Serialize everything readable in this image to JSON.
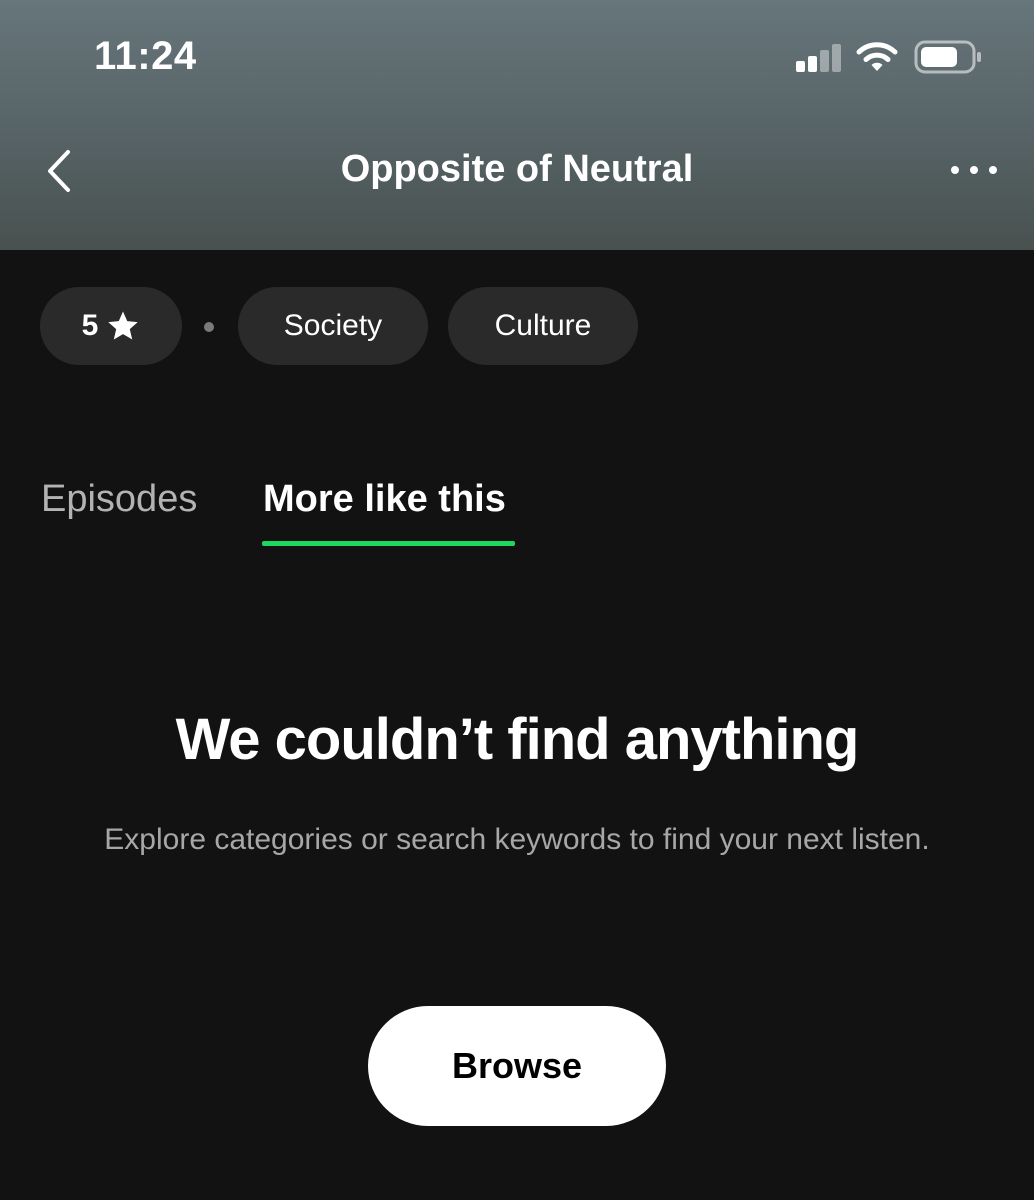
{
  "status_bar": {
    "time": "11:24",
    "signal_icon": "cellular-signal-icon",
    "wifi_icon": "wifi-icon",
    "battery_icon": "battery-icon"
  },
  "nav": {
    "back_icon": "chevron-left-icon",
    "title": "Opposite of Neutral",
    "more_icon": "more-horizontal-icon"
  },
  "chips": {
    "rating": "5",
    "rating_icon": "star-icon",
    "categories": [
      "Society",
      "Culture"
    ]
  },
  "tabs": [
    {
      "label": "Episodes",
      "active": false
    },
    {
      "label": "More like this",
      "active": true
    }
  ],
  "empty_state": {
    "title": "We couldn’t find anything",
    "message": "Explore categories or search keywords to find your next listen.",
    "button_label": "Browse"
  },
  "colors": {
    "background": "#121212",
    "accent": "#1ed760",
    "chip_background": "#2a2a2a",
    "muted_text": "#a7a7a7"
  }
}
